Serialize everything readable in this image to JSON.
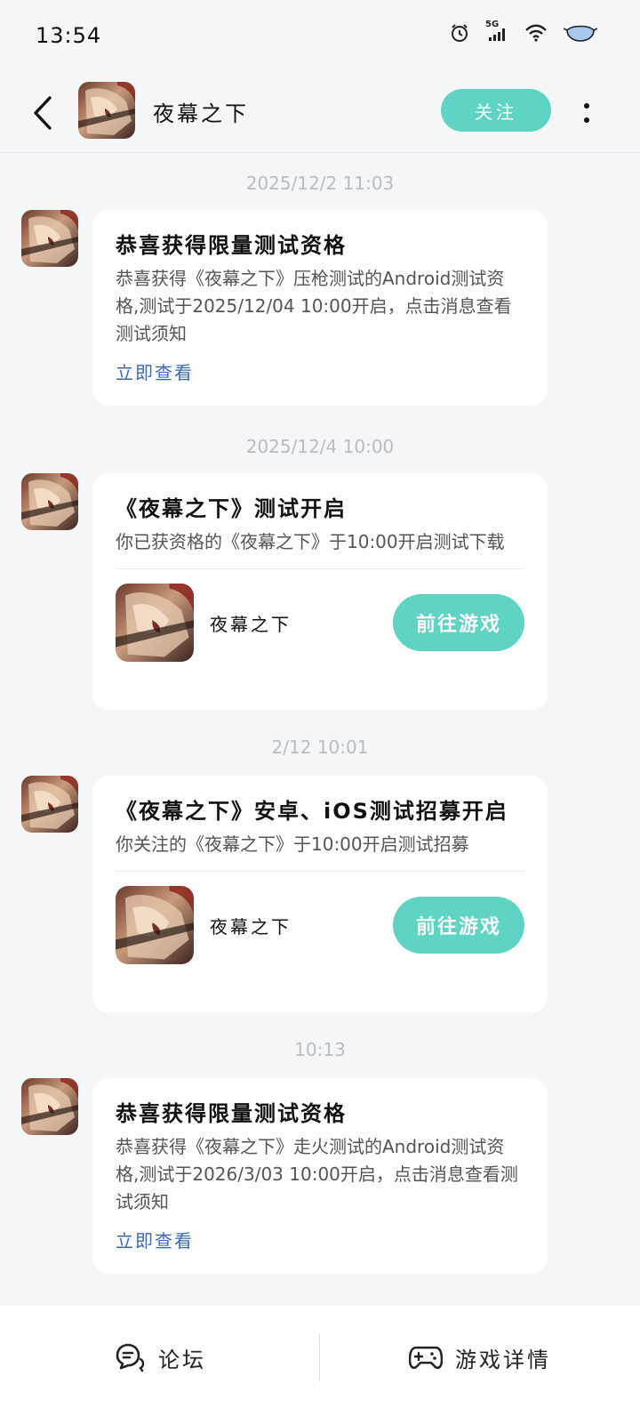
{
  "status_bar": {
    "time": "13:54",
    "network": "5G"
  },
  "header": {
    "title": "夜幕之下",
    "follow_label": "关注"
  },
  "colors": {
    "accent": "#5fd4c4",
    "link": "#3a6bb3",
    "background": "#f5f6f8"
  },
  "messages": [
    {
      "timestamp": "2025/12/2 11:03",
      "title": "恭喜获得限量测试资格",
      "body": "恭喜获得《夜幕之下》压枪测试的Android测试资格,测试于2025/12/04 10:00开启，点击消息查看测试须知",
      "link": "立即查看"
    },
    {
      "timestamp": "2025/12/4 10:00",
      "title": "《夜幕之下》测试开启",
      "body": "你已获资格的《夜幕之下》于10:00开启测试下载",
      "game_name": "夜幕之下",
      "button": "前往游戏"
    },
    {
      "timestamp": "2/12 10:01",
      "title": "《夜幕之下》安卓、iOS测试招募开启",
      "body": "你关注的《夜幕之下》于10:00开启测试招募",
      "game_name": "夜幕之下",
      "button": "前往游戏"
    },
    {
      "timestamp": "10:13",
      "title": "恭喜获得限量测试资格",
      "body": "恭喜获得《夜幕之下》走火测试的Android测试资格,测试于2026/3/03 10:00开启，点击消息查看测试须知",
      "link": "立即查看"
    }
  ],
  "bottom_nav": [
    {
      "label": "论坛",
      "icon": "forum-chat-icon"
    },
    {
      "label": "游戏详情",
      "icon": "gamepad-icon"
    }
  ]
}
